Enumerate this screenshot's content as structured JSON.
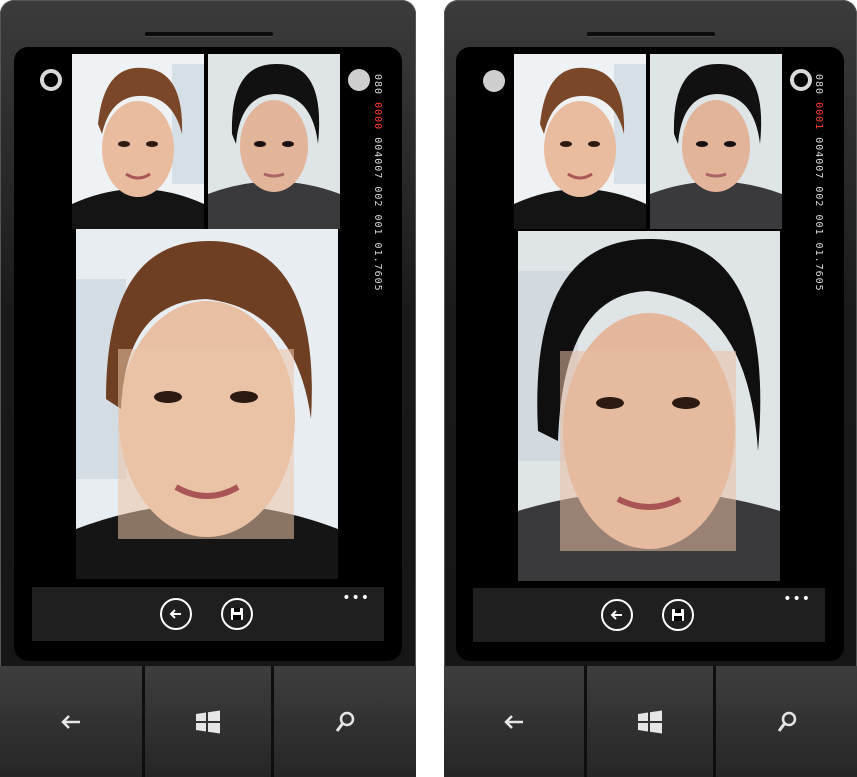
{
  "screens": [
    {
      "id": "left",
      "film_strip": {
        "top": "080",
        "mid": "0000",
        "bottom": "004007 002 001 01.7605"
      },
      "circle_left": "outline",
      "circle_right": "filled",
      "appbar": {
        "back_icon": "arrow-left-icon",
        "save_icon": "floppy-disk-icon",
        "more_label": "•••"
      }
    },
    {
      "id": "right",
      "film_strip": {
        "top": "080",
        "mid": "0001",
        "bottom": "004007 002 001 01.7605"
      },
      "circle_left": "filled",
      "circle_right": "outline",
      "appbar": {
        "back_icon": "arrow-left-icon",
        "save_icon": "floppy-disk-icon",
        "more_label": "•••"
      }
    }
  ],
  "hardware_buttons": [
    "back-arrow-icon",
    "windows-logo-icon",
    "search-icon"
  ],
  "colors": {
    "screen_bg": "#000000",
    "appbar_bg": "#1f1f1f",
    "accent_red": "#ff3b2f",
    "bezel": "#2a2a2a"
  }
}
